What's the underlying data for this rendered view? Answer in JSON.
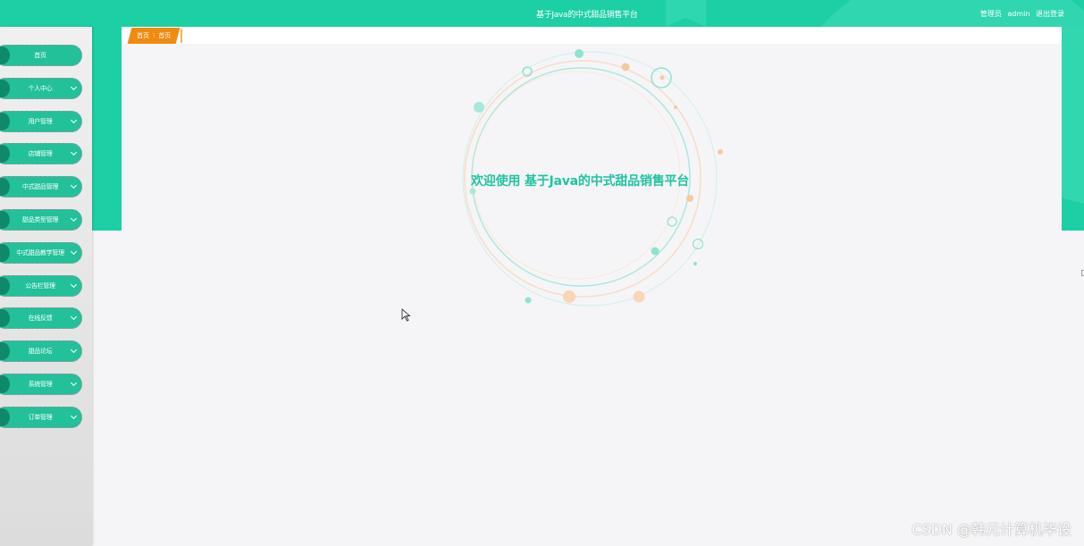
{
  "header": {
    "title": "基于Java的中式甜品销售平台",
    "role_label": "管理员",
    "username": "admin",
    "logout_label": "退出登录"
  },
  "sidebar": {
    "items": [
      {
        "label": "首页",
        "has_chevron": false
      },
      {
        "label": "个人中心",
        "has_chevron": true
      },
      {
        "label": "用户管理",
        "has_chevron": true
      },
      {
        "label": "店铺管理",
        "has_chevron": true
      },
      {
        "label": "中式甜品管理",
        "has_chevron": true
      },
      {
        "label": "甜品类型管理",
        "has_chevron": true
      },
      {
        "label": "中式甜品教学管理",
        "has_chevron": true
      },
      {
        "label": "公告栏管理",
        "has_chevron": true
      },
      {
        "label": "在线反馈",
        "has_chevron": true
      },
      {
        "label": "甜品论坛",
        "has_chevron": true
      },
      {
        "label": "系统管理",
        "has_chevron": true
      },
      {
        "label": "订单管理",
        "has_chevron": true
      }
    ]
  },
  "breadcrumb": {
    "root": "首页",
    "separator": "⁝",
    "current": "首页"
  },
  "main": {
    "welcome_text": "欢迎使用 基于Java的中式甜品销售平台"
  },
  "watermark": "CSDN @韩元计算机毕设",
  "colors": {
    "primary": "#1ccfa4",
    "sidebar_item": "#22c199",
    "breadcrumb": "#f08b10",
    "welcome_text": "#1fc4a0"
  },
  "icons": {
    "menu_expand": "chevron-down-icon",
    "cursor": "mouse-pointer-icon"
  }
}
